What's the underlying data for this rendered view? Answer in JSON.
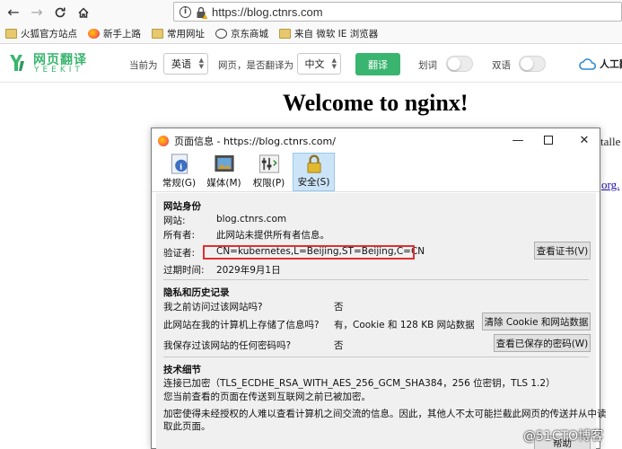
{
  "browser": {
    "url_text": "https://blog.ctnrs.com"
  },
  "bookmarks": [
    {
      "label": "火狐官方站点",
      "icon": "folder-icon"
    },
    {
      "label": "新手上路",
      "icon": "firefox-icon"
    },
    {
      "label": "常用网址",
      "icon": "folder-icon"
    },
    {
      "label": "京东商城",
      "icon": "globe-icon"
    },
    {
      "label": "来自 微软 IE 浏览器",
      "icon": "folder-icon"
    }
  ],
  "translate": {
    "logo_cn": "网页翻译",
    "logo_en": "YEEKIT",
    "current_label": "当前为",
    "source_lang": "英语",
    "question_label": "网页，是否翻译为",
    "target_lang": "中文",
    "translate_button": "翻译",
    "highlight_label": "划词",
    "bilingual_label": "双语",
    "human_label": "人工翻"
  },
  "page": {
    "title": "Welcome to nginx!",
    "fragment1": "talle",
    "fragment2": "org."
  },
  "dialog": {
    "title": "页面信息 - https://blog.ctnrs.com/",
    "tabs": [
      {
        "label": "常规(G)"
      },
      {
        "label": "媒体(M)"
      },
      {
        "label": "权限(P)"
      },
      {
        "label": "安全(S)"
      }
    ],
    "identity": {
      "heading": "网站身份",
      "site_label": "网站:",
      "site_value": "blog.ctnrs.com",
      "owner_label": "所有者:",
      "owner_value": "此网站未提供所有者信息。",
      "verifier_label": "验证者:",
      "verifier_value": "CN=kubernetes,L=Beijing,ST=Beijing,C=CN",
      "expiry_label": "过期时间:",
      "expiry_value": "2029年9月1日",
      "view_cert_button": "查看证书(V)"
    },
    "privacy": {
      "heading": "隐私和历史记录",
      "q1": "我之前访问过该网站吗?",
      "a1": "否",
      "q2": "此网站在我的计算机上存储了信息吗?",
      "a2": "有，Cookie 和 128 KB 网站数据",
      "clear_button": "清除 Cookie 和网站数据",
      "q3": "我保存过该网站的任何密码吗?",
      "a3": "否",
      "view_pw_button": "查看已保存的密码(W)"
    },
    "technical": {
      "heading": "技术细节",
      "line1": "连接已加密（TLS_ECDHE_RSA_WITH_AES_256_GCM_SHA384，256 位密钥，TLS 1.2）",
      "line2": "您当前查看的页面在传送到互联网之前已被加密。",
      "line3": "加密使得未经授权的人难以查看计算机之间交流的信息。因此，其他人不太可能拦截此网页的传送并从中读",
      "line4": "取此页面。",
      "help_button": "帮助"
    }
  },
  "watermark": "@51CTO博客"
}
